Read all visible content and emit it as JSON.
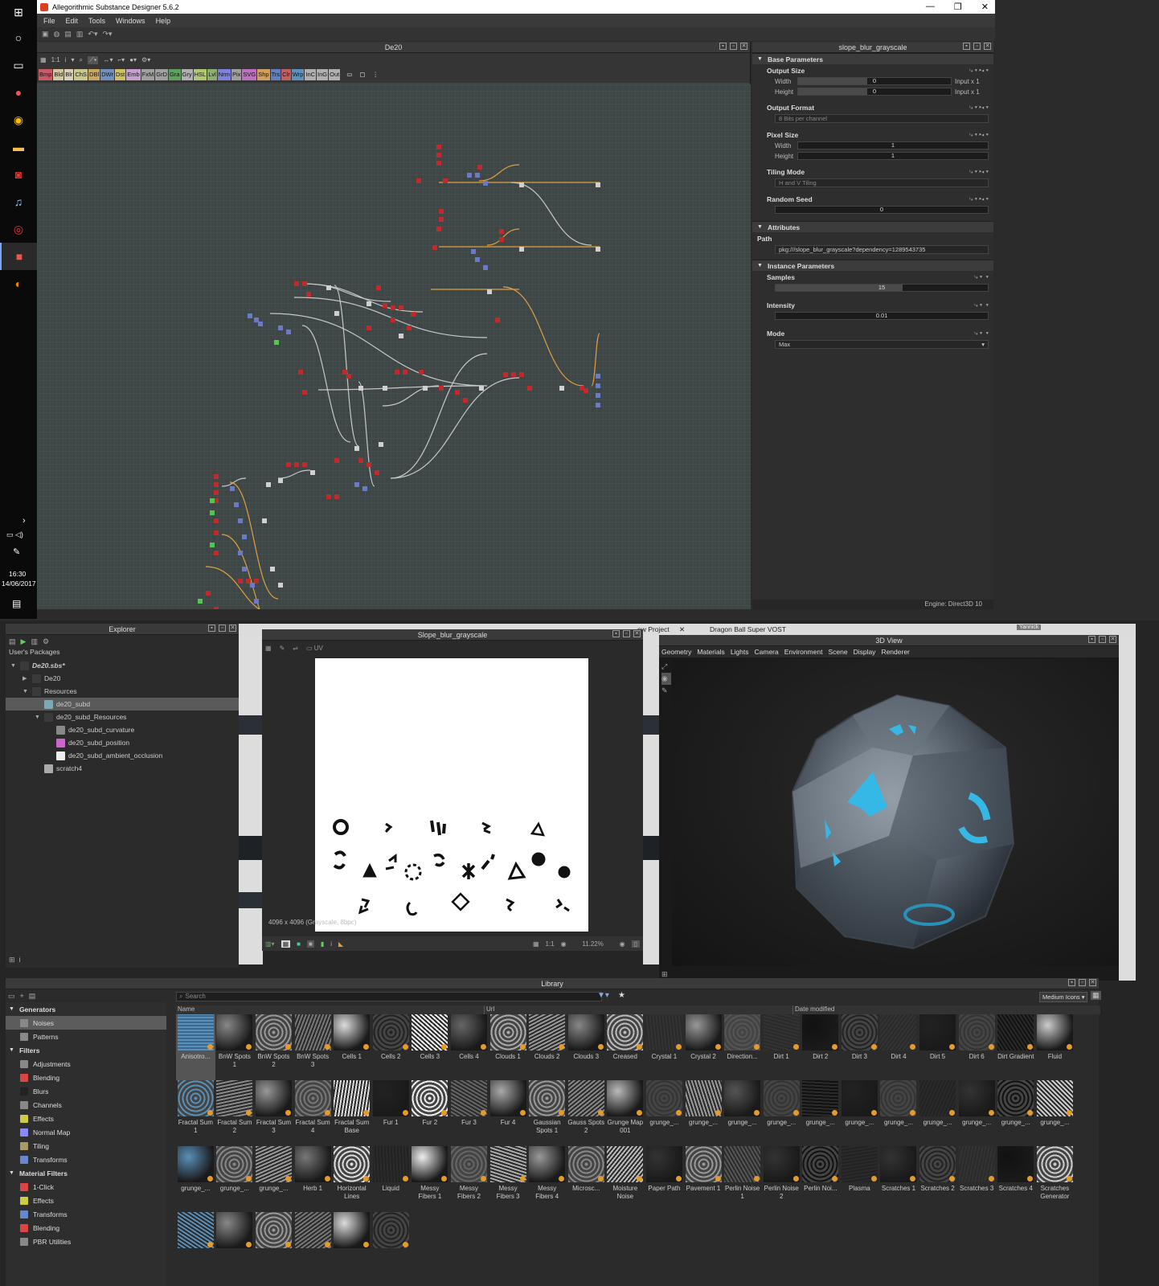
{
  "window": {
    "title": "Allegorithmic Substance Designer 5.6.2",
    "menu": [
      "File",
      "Edit",
      "Tools",
      "Windows",
      "Help"
    ]
  },
  "taskbar": {
    "time": "16:30",
    "date": "14/06/2017"
  },
  "graph": {
    "title": "De20",
    "zoom_label": "1:1",
    "node_tabs": [
      {
        "label": "Bmp",
        "color": "#c85a6a"
      },
      {
        "label": "Bld",
        "color": "#d0c8a0"
      },
      {
        "label": "Blr",
        "color": "#d8d0b8"
      },
      {
        "label": "ChS",
        "color": "#c8c890"
      },
      {
        "label": "DBl",
        "color": "#c8a860"
      },
      {
        "label": "DWr",
        "color": "#7090c0"
      },
      {
        "label": "Dst",
        "color": "#d0c060"
      },
      {
        "label": "Emb",
        "color": "#c8a0d0"
      },
      {
        "label": "FxM",
        "color": "#a0a0a0"
      },
      {
        "label": "GrD",
        "color": "#a0a0a0"
      },
      {
        "label": "Gra",
        "color": "#60a060"
      },
      {
        "label": "Gry",
        "color": "#b0b0b0"
      },
      {
        "label": "HSL",
        "color": "#b0c870"
      },
      {
        "label": "Lvl",
        "color": "#8ab070"
      },
      {
        "label": "Nrm",
        "color": "#8080e0"
      },
      {
        "label": "Pix",
        "color": "#a0a0a0"
      },
      {
        "label": "SVG",
        "color": "#c070c0"
      },
      {
        "label": "Shp",
        "color": "#d0a060"
      },
      {
        "label": "Trs",
        "color": "#6080c0"
      },
      {
        "label": "Clr",
        "color": "#c06060"
      },
      {
        "label": "Wrp",
        "color": "#6090c0"
      },
      {
        "label": "InC",
        "color": "#b0b0b0"
      },
      {
        "label": "InG",
        "color": "#b0b0b0"
      },
      {
        "label": "Out",
        "color": "#b0b0b0"
      }
    ]
  },
  "props": {
    "title": "slope_blur_grayscale",
    "base_parameters": "Base Parameters",
    "output_size": {
      "label": "Output Size",
      "width_label": "Width",
      "width_value": "0",
      "width_suffix": "Input x 1",
      "height_label": "Height",
      "height_value": "0",
      "height_suffix": "Input x 1"
    },
    "output_format": {
      "label": "Output Format",
      "value": "8 Bits per channel"
    },
    "pixel_size": {
      "label": "Pixel Size",
      "width_label": "Width",
      "width_value": "1",
      "height_label": "Height",
      "height_value": "1"
    },
    "tiling_mode": {
      "label": "Tiling Mode",
      "value": "H and V Tiling"
    },
    "random_seed": {
      "label": "Random Seed",
      "value": "0"
    },
    "attributes": "Attributes",
    "path": {
      "label": "Path",
      "value": "pkg:///slope_blur_grayscale?dependency=1289543735"
    },
    "instance_parameters": "Instance Parameters",
    "samples": {
      "label": "Samples",
      "value": "15",
      "fill": 0.6
    },
    "intensity": {
      "label": "Intensity",
      "value": "0.01"
    },
    "mode": {
      "label": "Mode",
      "value": "Max"
    },
    "engine": "Engine: Direct3D 10"
  },
  "explorer": {
    "title": "Explorer",
    "section": "User's Packages",
    "items": [
      {
        "label": "De20.sbs*",
        "indent": 0,
        "tw": "▼"
      },
      {
        "label": "De20",
        "indent": 1,
        "tw": "▶"
      },
      {
        "label": "Resources",
        "indent": 1,
        "tw": "▼"
      },
      {
        "label": "de20_subd",
        "indent": 2,
        "tw": ""
      },
      {
        "label": "de20_subd_Resources",
        "indent": 2,
        "tw": "▼"
      },
      {
        "label": "de20_subd_curvature",
        "indent": 3,
        "tw": ""
      },
      {
        "label": "de20_subd_position",
        "indent": 3,
        "tw": ""
      },
      {
        "label": "de20_subd_ambient_occlusion",
        "indent": 3,
        "tw": ""
      },
      {
        "label": "scratch4",
        "indent": 2,
        "tw": ""
      }
    ]
  },
  "browser": {
    "tab1": "ew Project",
    "tab2": "Dragon Ball Super VOST",
    "user": "Yannick"
  },
  "view2d": {
    "title": "Slope_blur_grayscale",
    "mode": "UV",
    "info": "4096 x 4096 (Grayscale, 8bpc)",
    "zoom_ratio": "1:1",
    "zoom": "11.22%"
  },
  "view3d": {
    "title": "3D View",
    "menu": [
      "Geometry",
      "Materials",
      "Lights",
      "Camera",
      "Environment",
      "Scene",
      "Display",
      "Renderer"
    ]
  },
  "library": {
    "title": "Library",
    "search_placeholder": "Search",
    "view_mode": "Medium Icons",
    "columns": [
      "Name",
      "Url",
      "Date modified"
    ],
    "categories": [
      {
        "label": "Generators",
        "type": "head"
      },
      {
        "label": "Noises",
        "type": "sub",
        "sel": true,
        "color": "#888"
      },
      {
        "label": "Patterns",
        "type": "sub",
        "color": "#888"
      },
      {
        "label": "Filters",
        "type": "head"
      },
      {
        "label": "Adjustments",
        "type": "sub",
        "color": "#888"
      },
      {
        "label": "Blending",
        "type": "sub",
        "color": "#d44"
      },
      {
        "label": "Blurs",
        "type": "sub",
        "color": "#222"
      },
      {
        "label": "Channels",
        "type": "sub",
        "color": "#888"
      },
      {
        "label": "Effects",
        "type": "sub",
        "color": "#cc4"
      },
      {
        "label": "Normal Map",
        "type": "sub",
        "color": "#88f"
      },
      {
        "label": "Tiling",
        "type": "sub",
        "color": "#a96"
      },
      {
        "label": "Transforms",
        "type": "sub",
        "color": "#68c"
      },
      {
        "label": "Material Filters",
        "type": "head"
      },
      {
        "label": "1-Click",
        "type": "sub",
        "color": "#d44"
      },
      {
        "label": "Effects",
        "type": "sub",
        "color": "#cc4"
      },
      {
        "label": "Transforms",
        "type": "sub",
        "color": "#68c"
      },
      {
        "label": "Blending",
        "type": "sub",
        "color": "#d44"
      },
      {
        "label": "PBR Utilities",
        "type": "sub",
        "color": "#888"
      }
    ],
    "tiles": [
      "Anisotro...",
      "BnW Spots 1",
      "BnW Spots 2",
      "BnW Spots 3",
      "Cells 1",
      "Cells 2",
      "Cells 3",
      "Cells 4",
      "Clouds 1",
      "Clouds 2",
      "Clouds 3",
      "Creased",
      "Crystal 1",
      "Crystal 2",
      "Direction...",
      "Dirt 1",
      "Dirt 2",
      "Dirt 3",
      "Dirt 4",
      "Dirt 5",
      "Dirt 6",
      "Dirt Gradient",
      "Fluid",
      "Fractal Sum 1",
      "Fractal Sum 2",
      "Fractal Sum 3",
      "Fractal Sum 4",
      "Fractal Sum Base",
      "Fur 1",
      "Fur 2",
      "Fur 3",
      "Fur 4",
      "Gaussian Spots 1",
      "Gauss Spots 2",
      "Grunge Map 001",
      "grunge_...",
      "grunge_...",
      "grunge_...",
      "grunge_...",
      "grunge_...",
      "grunge_...",
      "grunge_...",
      "grunge_...",
      "grunge_...",
      "grunge_...",
      "grunge_...",
      "grunge_...",
      "grunge_...",
      "grunge_...",
      "Herb 1",
      "Horizontal Lines",
      "Liquid",
      "Messy Fibers 1",
      "Messy Fibers 2",
      "Messy Fibers 3",
      "Messy Fibers 4",
      "Microsc...",
      "Moisture Noise",
      "Paper Path",
      "Pavement 1",
      "Perlin Noise 1",
      "Perlin Noise 2",
      "Perlin Noi...",
      "Plasma",
      "Scratches 1",
      "Scratches 2",
      "Scratches 3",
      "Scratches 4",
      "Scratches Generator",
      "",
      "",
      "",
      "",
      "",
      ""
    ]
  }
}
